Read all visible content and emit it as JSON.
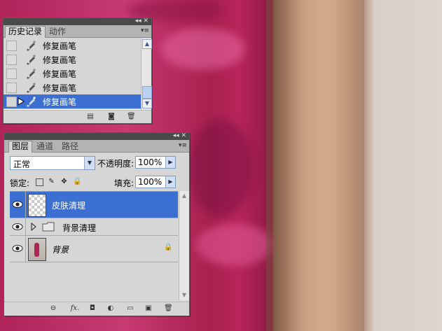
{
  "history_panel": {
    "tabs": [
      "历史记录",
      "动作"
    ],
    "items": [
      {
        "label": "修复画笔",
        "selected": false
      },
      {
        "label": "修复画笔",
        "selected": false
      },
      {
        "label": "修复画笔",
        "selected": false
      },
      {
        "label": "修复画笔",
        "selected": false
      },
      {
        "label": "修复画笔",
        "selected": true
      }
    ]
  },
  "layers_panel": {
    "tabs": [
      "图层",
      "通道",
      "路径"
    ],
    "blend_mode": "正常",
    "opacity_label": "不透明度:",
    "opacity_value": "100%",
    "lock_label": "锁定:",
    "fill_label": "填充:",
    "fill_value": "100%",
    "layers": [
      {
        "name": "皮肤清理",
        "selected": true,
        "type": "layer"
      },
      {
        "name": "背景清理",
        "selected": false,
        "type": "group"
      },
      {
        "name": "背景",
        "selected": false,
        "type": "background"
      }
    ]
  },
  "colors": {
    "selection": "#3b6fd1",
    "panel_bg": "#d6d6d6",
    "titlebar": "#4a4a4a",
    "dress": "#b0245a",
    "skin": "#c29a7c"
  }
}
